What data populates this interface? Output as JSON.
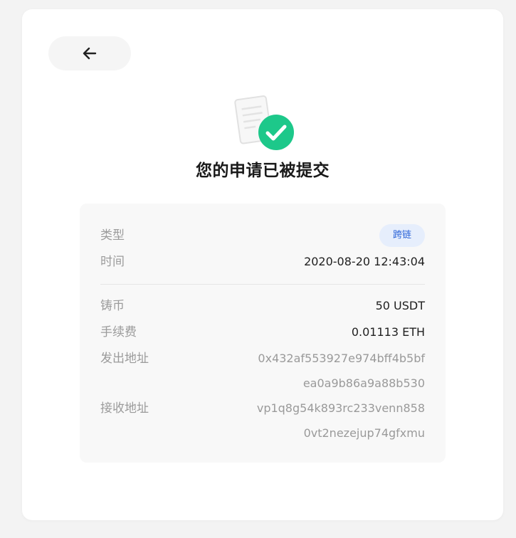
{
  "title": "您的申请已被提交",
  "details": {
    "type_label": "类型",
    "type_value": "跨链",
    "time_label": "时间",
    "time_value": "2020-08-20 12:43:04",
    "mint_label": "铸币",
    "mint_value": "50 USDT",
    "fee_label": "手续费",
    "fee_value": "0.01113 ETH",
    "from_label": "发出地址",
    "from_line1": "0x432af553927e974bff4b5bf",
    "from_line2": "ea0a9b86a9a88b530",
    "to_label": "接收地址",
    "to_line1": "vp1q8g54k893rc233venn858",
    "to_line2": "0vt2nezejup74gfxmu"
  },
  "colors": {
    "success": "#1dc88a",
    "badge_bg": "#e6eefc",
    "badge_text": "#2a63d8"
  },
  "icons": {
    "back": "arrow-left-icon",
    "document": "document-icon",
    "success": "checkmark-circle-icon"
  }
}
